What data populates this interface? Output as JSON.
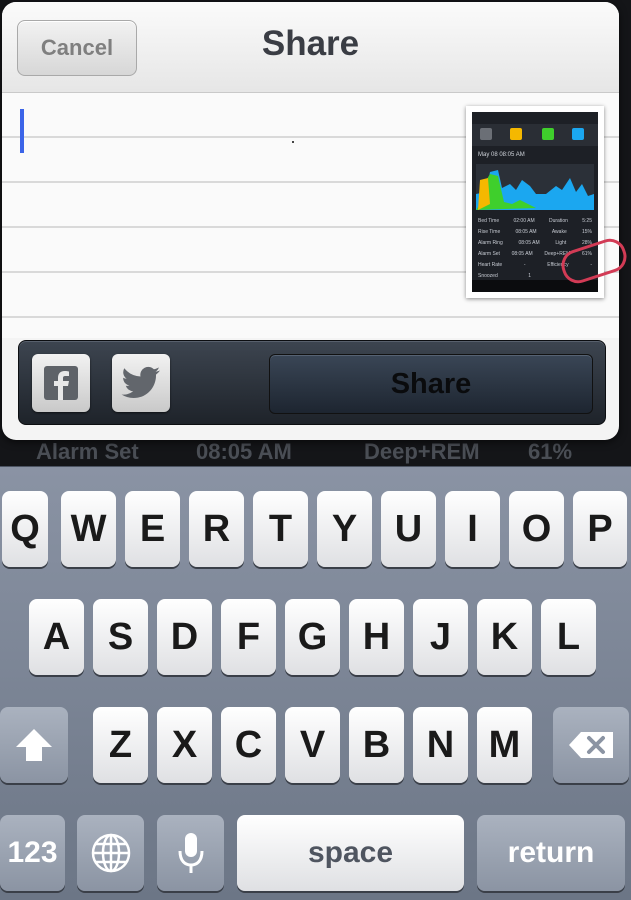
{
  "background": {
    "row_label": "Alarm Set",
    "row_time": "08:05 AM",
    "row_metric": "Deep+REM",
    "row_value": "61%"
  },
  "sheet": {
    "cancel_label": "Cancel",
    "title": "Share",
    "compose_text": "",
    "share_label": "Share",
    "facebook_icon": "facebook-icon",
    "twitter_icon": "twitter-icon"
  },
  "attachment": {
    "date": "May 08 08:05 AM",
    "stats": [
      [
        "Bed Time",
        "02:00 AM",
        "Duration",
        "5:25"
      ],
      [
        "Rise Time",
        "08:05 AM",
        "Awake",
        "15%"
      ],
      [
        "Alarm Ring",
        "08:05 AM",
        "Light",
        "28%"
      ],
      [
        "Alarm Set",
        "08:05 AM",
        "Deep+REM",
        "61%"
      ],
      [
        "Heart Rate",
        "-",
        "Efficiency",
        "-"
      ],
      [
        "Snoozed",
        "1",
        "",
        ""
      ]
    ],
    "legend_colors": [
      "#6b6f76",
      "#f5b800",
      "#3fcf2c",
      "#1ba7f0"
    ]
  },
  "keyboard": {
    "row1": [
      "Q",
      "W",
      "E",
      "R",
      "T",
      "Y",
      "U",
      "I",
      "O",
      "P"
    ],
    "row2": [
      "A",
      "S",
      "D",
      "F",
      "G",
      "H",
      "J",
      "K",
      "L"
    ],
    "row3": [
      "Z",
      "X",
      "C",
      "V",
      "B",
      "N",
      "M"
    ],
    "numbers_label": "123",
    "space_label": "space",
    "return_label": "return"
  }
}
